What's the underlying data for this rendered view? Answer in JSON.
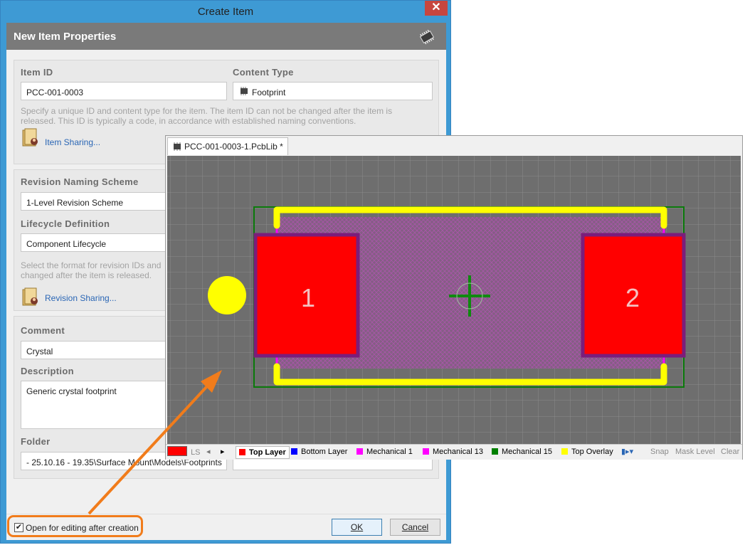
{
  "window": {
    "title": "Create Item",
    "close_glyph": "✕"
  },
  "header": {
    "title": "New Item Properties",
    "icon": "chip-icon"
  },
  "item": {
    "id_label": "Item ID",
    "id_value": "PCC-001-0003",
    "type_label": "Content Type",
    "type_value": "Footprint",
    "hint": "Specify a unique ID and content type for the item. The item ID can not be changed after the item is released. This ID is typically a code, in accordance with established naming conventions.",
    "sharing_link": "Item Sharing..."
  },
  "revision": {
    "naming_label": "Revision Naming Scheme",
    "naming_value": "1-Level Revision Scheme",
    "lifecycle_label": "Lifecycle Definition",
    "lifecycle_value": "Component Lifecycle",
    "hint_line1": "Select the format for revision IDs and",
    "hint_line2": "changed after the item is released.",
    "sharing_link": "Revision Sharing..."
  },
  "details": {
    "comment_label": "Comment",
    "comment_value": "Crystal",
    "description_label": "Description",
    "description_value": "Generic crystal footprint",
    "folder_label": "Folder",
    "folder_value": "- 25.10.16 - 19.35\\Surface Mount\\Models\\Footprints"
  },
  "footer": {
    "open_label": "Open for editing after creation",
    "open_checked": "✔",
    "ok_label": "OK",
    "cancel_label": "Cancel"
  },
  "editor": {
    "tab_label": "PCC-001-0003-1.PcbLib *",
    "pad1_label": "1",
    "pad2_label": "2",
    "ls_label": "LS",
    "layers": [
      {
        "name": "Top Layer",
        "color": "#ff0000",
        "active": true
      },
      {
        "name": "Bottom Layer",
        "color": "#0000ff",
        "active": false
      },
      {
        "name": "Mechanical 1",
        "color": "#ff00ff",
        "active": false
      },
      {
        "name": "Mechanical 13",
        "color": "#ff00ff",
        "active": false
      },
      {
        "name": "Mechanical 15",
        "color": "#008000",
        "active": false
      },
      {
        "name": "Top Overlay",
        "color": "#ffff00",
        "active": false
      }
    ],
    "snap_label": "Snap",
    "mask_label": "Mask Level",
    "clear_label": "Clear"
  },
  "colors": {
    "canvas": "#6e6e6e",
    "grid": "#8b8b8b",
    "pad": "#ff0000",
    "pad_outline": "#7b1d7b",
    "overlay": "#ffff00",
    "mechanical": "#ff00ff",
    "courtyard": "#008000",
    "arrow": "#f17c1b"
  }
}
